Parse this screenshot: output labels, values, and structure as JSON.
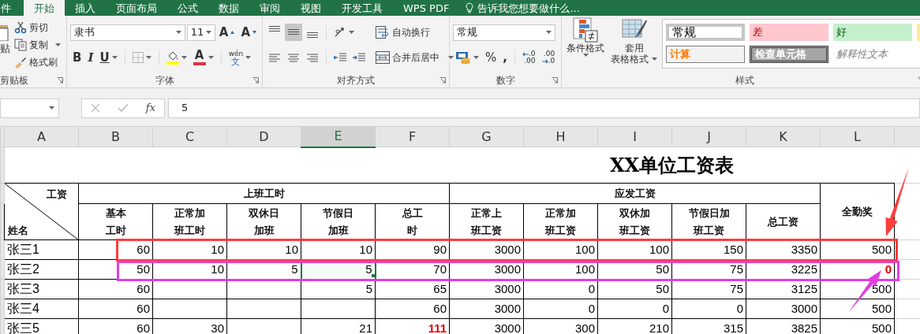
{
  "ribbon_tabs": [
    {
      "label": "件",
      "selected": false
    },
    {
      "label": "开始",
      "selected": true
    },
    {
      "label": "插入",
      "selected": false
    },
    {
      "label": "页面布局",
      "selected": false
    },
    {
      "label": "公式",
      "selected": false
    },
    {
      "label": "数据",
      "selected": false
    },
    {
      "label": "审阅",
      "selected": false
    },
    {
      "label": "视图",
      "selected": false
    },
    {
      "label": "开发工具",
      "selected": false
    },
    {
      "label": "WPS PDF",
      "selected": false
    }
  ],
  "tell_me": "告诉我您想要做什么...",
  "clipboard": {
    "paste": "贴",
    "cut": "剪切",
    "copy": "复制",
    "format_painter": "格式刷",
    "label": "剪贴板"
  },
  "font": {
    "name": "隶书",
    "size": "11",
    "grow": "A",
    "shrink": "A",
    "bold": "B",
    "italic": "I",
    "underline": "U",
    "font_color_glyph": "A",
    "phonetic": "wén",
    "phonetic_char": "文",
    "label": "字体"
  },
  "alignment": {
    "vertical": [
      {
        "kind": "top",
        "selected": false
      },
      {
        "kind": "middle",
        "selected": true
      },
      {
        "kind": "bottom",
        "selected": false
      }
    ],
    "wrap": "自动换行",
    "merge": "合并后居中",
    "label": "对齐方式"
  },
  "number": {
    "format": "常规",
    "percent": "%",
    "comma": ",",
    "decimals": [
      {
        "kind": "increase",
        "top": ".0",
        "bottom": ".00"
      },
      {
        "kind": "decrease",
        "top": ".00",
        "bottom": ".0"
      }
    ],
    "label": "数字"
  },
  "styles": {
    "conditional": "条件格式",
    "table_format": [
      "套用",
      "表格格式"
    ],
    "label": "样式",
    "gallery": [
      {
        "label": "常规",
        "kind": "normal",
        "selected": true
      },
      {
        "label": "差",
        "kind": "bad",
        "selected": false
      },
      {
        "label": "好",
        "kind": "good",
        "selected": false
      },
      {
        "kind": "neutral",
        "selected": false
      },
      {
        "label": "计算",
        "kind": "calc",
        "selected": false
      },
      {
        "label": "检查单元格",
        "kind": "check",
        "selected": false
      },
      {
        "label": "解释性文本",
        "kind": "note",
        "selected": false
      }
    ]
  },
  "formula_bar": {
    "function_label": "fx",
    "value": "5"
  },
  "columns": [
    {
      "label": "A",
      "selected": false
    },
    {
      "label": "B",
      "selected": false
    },
    {
      "label": "C",
      "selected": false
    },
    {
      "label": "D",
      "selected": false
    },
    {
      "label": "E",
      "selected": true
    },
    {
      "label": "F",
      "selected": false
    },
    {
      "label": "G",
      "selected": false
    },
    {
      "label": "H",
      "selected": false
    },
    {
      "label": "I",
      "selected": false
    },
    {
      "label": "J",
      "selected": false
    },
    {
      "label": "K",
      "selected": false
    },
    {
      "label": "L",
      "selected": false
    }
  ],
  "sheet": {
    "title": "XX单位工资表",
    "corner_top": "工资",
    "corner_bottom": "姓名",
    "groups": [
      {
        "label": "上班工时",
        "columns": [
          [
            "基本",
            "工时"
          ],
          [
            "正常加",
            "班工时"
          ],
          [
            "双休日",
            "加班"
          ],
          [
            "节假日",
            "加班"
          ],
          [
            "总工",
            "时"
          ]
        ]
      },
      {
        "label": "应发工资",
        "columns": [
          [
            "正常上",
            "班工资"
          ],
          [
            "正常加",
            "班工资"
          ],
          [
            "双休加",
            "班工资"
          ],
          [
            "节假日加",
            "班工资"
          ],
          [
            "总工资"
          ]
        ]
      }
    ],
    "extra_column": "全勤奖",
    "rows": [
      {
        "name": "张三1",
        "color": "#ff3b3b",
        "cells": [
          {
            "text": "60",
            "selected": false,
            "alert": false
          },
          {
            "text": "10",
            "selected": false,
            "alert": false
          },
          {
            "text": "10",
            "selected": false,
            "alert": false
          },
          {
            "text": "10",
            "selected": false,
            "alert": false
          },
          {
            "text": "90",
            "selected": false,
            "alert": false
          },
          {
            "text": "3000",
            "selected": false,
            "alert": false
          },
          {
            "text": "100",
            "selected": false,
            "alert": false
          },
          {
            "text": "100",
            "selected": false,
            "alert": false
          },
          {
            "text": "150",
            "selected": false,
            "alert": false
          },
          {
            "text": "3350",
            "selected": false,
            "alert": false
          },
          {
            "text": "500",
            "selected": false,
            "alert": false
          }
        ]
      },
      {
        "name": "张三2",
        "color": "#e23de2",
        "cells": [
          {
            "text": "50",
            "selected": false,
            "alert": false
          },
          {
            "text": "10",
            "selected": false,
            "alert": false
          },
          {
            "text": "5",
            "selected": false,
            "alert": false
          },
          {
            "text": "5",
            "selected": true,
            "alert": false
          },
          {
            "text": "70",
            "selected": false,
            "alert": false
          },
          {
            "text": "3000",
            "selected": false,
            "alert": false
          },
          {
            "text": "100",
            "selected": false,
            "alert": false
          },
          {
            "text": "50",
            "selected": false,
            "alert": false
          },
          {
            "text": "75",
            "selected": false,
            "alert": false
          },
          {
            "text": "3225",
            "selected": false,
            "alert": false
          },
          {
            "text": "0",
            "selected": false,
            "alert": true
          }
        ]
      },
      {
        "name": "张三3",
        "cells": [
          {
            "text": "60",
            "selected": false,
            "alert": false
          },
          {
            "selected": false
          },
          {
            "selected": false
          },
          {
            "text": "5",
            "selected": false,
            "alert": false
          },
          {
            "text": "65",
            "selected": false,
            "alert": false
          },
          {
            "text": "3000",
            "selected": false,
            "alert": false
          },
          {
            "text": "0",
            "selected": false,
            "alert": false
          },
          {
            "text": "50",
            "selected": false,
            "alert": false
          },
          {
            "text": "75",
            "selected": false,
            "alert": false
          },
          {
            "text": "3125",
            "selected": false,
            "alert": false
          },
          {
            "text": "500",
            "selected": false,
            "alert": false
          }
        ]
      },
      {
        "name": "张三4",
        "cells": [
          {
            "text": "60",
            "selected": false,
            "alert": false
          },
          {
            "selected": false
          },
          {
            "selected": false
          },
          {
            "selected": false
          },
          {
            "text": "60",
            "selected": false,
            "alert": false
          },
          {
            "text": "3000",
            "selected": false,
            "alert": false
          },
          {
            "text": "0",
            "selected": false,
            "alert": false
          },
          {
            "text": "0",
            "selected": false,
            "alert": false
          },
          {
            "text": "0",
            "selected": false,
            "alert": false
          },
          {
            "text": "3000",
            "selected": false,
            "alert": false
          },
          {
            "text": "500",
            "selected": false,
            "alert": false
          }
        ]
      },
      {
        "name": "张三5",
        "cells": [
          {
            "text": "60",
            "selected": false,
            "alert": false
          },
          {
            "text": "30",
            "selected": false,
            "alert": false
          },
          {
            "selected": false
          },
          {
            "text": "21",
            "selected": false,
            "alert": false
          },
          {
            "text": "111",
            "selected": false,
            "alert": true
          },
          {
            "text": "3000",
            "selected": false,
            "alert": false
          },
          {
            "text": "300",
            "selected": false,
            "alert": false
          },
          {
            "text": "210",
            "selected": false,
            "alert": false
          },
          {
            "text": "315",
            "selected": false,
            "alert": false
          },
          {
            "text": "3825",
            "selected": false,
            "alert": false
          },
          {
            "text": "500",
            "selected": false,
            "alert": false
          }
        ]
      }
    ]
  },
  "annotations": [
    {
      "kind": "arrow",
      "color": "#ff3b3b"
    },
    {
      "kind": "arrow",
      "color": "#e23de2"
    }
  ]
}
